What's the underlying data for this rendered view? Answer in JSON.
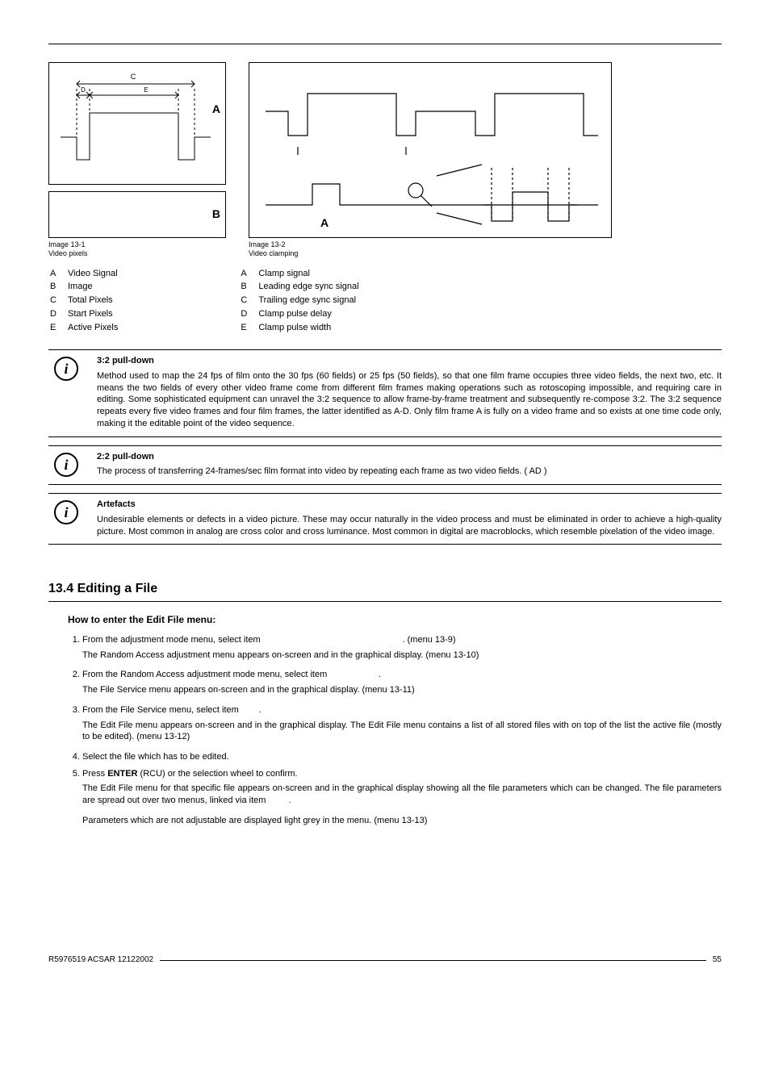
{
  "figures": {
    "left": {
      "id": "Image 13-1",
      "title": "Video pixels",
      "labels": {
        "A": "A",
        "B": "B"
      },
      "legend": [
        {
          "k": "A",
          "v": "Video Signal"
        },
        {
          "k": "B",
          "v": "Image"
        },
        {
          "k": "C",
          "v": "Total Pixels"
        },
        {
          "k": "D",
          "v": "Start Pixels"
        },
        {
          "k": "E",
          "v": "Active Pixels"
        }
      ]
    },
    "right": {
      "id": "Image 13-2",
      "title": "Video clamping",
      "labels": {
        "A": "A"
      },
      "legend": [
        {
          "k": "A",
          "v": "Clamp signal"
        },
        {
          "k": "B",
          "v": "Leading edge sync signal"
        },
        {
          "k": "C",
          "v": "Trailing edge sync signal"
        },
        {
          "k": "D",
          "v": "Clamp pulse delay"
        },
        {
          "k": "E",
          "v": "Clamp pulse width"
        }
      ]
    }
  },
  "notes": {
    "n1": {
      "title": "3:2 pull-down",
      "body": "Method used to map the 24 fps of film onto the 30 fps (60 fields) or 25 fps (50 fields), so that one film frame occupies three video fields, the next two, etc. It means the two fields of every other video frame come from different film frames making operations such as rotoscoping impossible, and requiring care in editing. Some sophisticated equipment can unravel the 3:2 sequence to allow frame-by-frame treatment and subsequently re-compose 3:2. The 3:2 sequence repeats every five video frames and four film frames, the latter identified as A-D. Only film frame A is fully on a video frame and so exists at one time code only, making it the editable point of the video sequence."
    },
    "n2": {
      "title": "2:2 pull-down",
      "body": "The process of transferring 24-frames/sec film format into video by repeating each frame as two video fields. ( AD )"
    },
    "n3": {
      "title": "Artefacts",
      "body": "Undesirable elements or defects in a video picture. These may occur naturally in the video process and must be eliminated in order to achieve a high-quality picture. Most common in analog are cross color and cross luminance. Most common in digital are macroblocks, which resemble pixelation of the video image."
    }
  },
  "section": {
    "number_title": "13.4 Editing a File",
    "subhead": "How to enter the Edit File menu:",
    "steps": {
      "s1a": "From the adjustment mode menu, select item ",
      "s1ref": ". (menu 13-9)",
      "s1b": "The Random Access adjustment menu appears on-screen and in the graphical display. (menu 13-10)",
      "s2a": "From the Random Access adjustment mode menu, select item ",
      "s2dot": ".",
      "s2b": "The File Service menu appears on-screen and in the graphical display. (menu 13-11)",
      "s3a": "From the File Service menu, select item ",
      "s3dot": ".",
      "s3b": "The Edit File menu appears on-screen and in the graphical display. The Edit File menu contains a list of all stored files with on top of the list the active file (mostly to be edited). (menu 13-12)",
      "s4": "Select the file which has to be edited.",
      "s5a": "Press ",
      "s5enter": "ENTER",
      "s5b": " (RCU) or the selection wheel to confirm.",
      "s5c": "The Edit File menu for that specific file appears on-screen and in the graphical display showing all the file parameters which can be changed. The file parameters are spread out over two menus, linked via item ",
      "s5dot": ".",
      "s5d": "Parameters which are not adjustable are displayed light grey in the menu. (menu 13-13)"
    }
  },
  "footer": {
    "doc": "R5976519  ACSAR  12122002",
    "page": "55"
  }
}
